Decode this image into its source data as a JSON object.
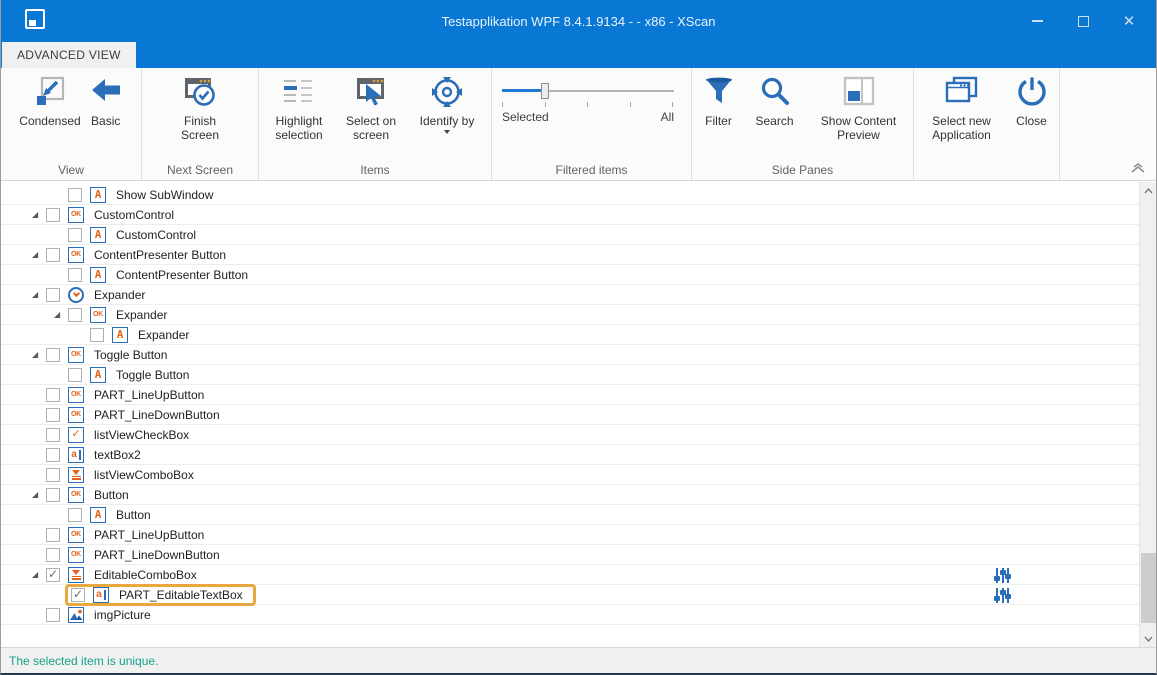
{
  "window": {
    "title": "Testapplikation WPF 8.4.1.9134 - - x86 - XScan",
    "control_icons": [
      "minimize-icon",
      "maximize-icon",
      "close-icon"
    ],
    "app_icon": "save-window-icon"
  },
  "tab": {
    "label": "ADVANCED VIEW"
  },
  "ribbon": {
    "groups": [
      {
        "label": "View",
        "buttons": [
          {
            "label": "Condensed",
            "icon": "condensed-icon"
          },
          {
            "label": "Basic",
            "icon": "basic-icon"
          }
        ]
      },
      {
        "label": "Next Screen",
        "buttons": [
          {
            "label": "Finish Screen",
            "icon": "finish-screen-icon"
          }
        ]
      },
      {
        "label": "Items",
        "buttons": [
          {
            "label": "Highlight selection",
            "icon": "highlight-selection-icon"
          },
          {
            "label": "Select on screen",
            "icon": "select-on-screen-icon"
          },
          {
            "label": "Identify by",
            "icon": "identify-by-icon",
            "dropdown": true
          }
        ]
      },
      {
        "label": "Filtered items",
        "slider": {
          "left_label": "Selected",
          "right_label": "All",
          "value_fraction": 0.25,
          "tick_count": 5
        }
      },
      {
        "label": "Side Panes",
        "buttons": [
          {
            "label": "Filter",
            "icon": "filter-icon"
          },
          {
            "label": "Search",
            "icon": "search-icon"
          },
          {
            "label": "Show Content Preview",
            "icon": "show-content-preview-icon"
          }
        ]
      },
      {
        "label": "",
        "buttons": [
          {
            "label": "Select new Application",
            "icon": "select-new-application-icon"
          },
          {
            "label": "Close",
            "icon": "close-app-icon"
          }
        ]
      }
    ],
    "collapse_icon": "collapse-ribbon-chevron-icon"
  },
  "tree": {
    "rows": [
      {
        "level": 1,
        "expander": false,
        "checked": false,
        "icon": "raw-item",
        "label": "Show SubWindow"
      },
      {
        "level": 0,
        "expander": true,
        "checked": false,
        "icon": "button",
        "label": "CustomControl"
      },
      {
        "level": 1,
        "expander": false,
        "checked": false,
        "icon": "raw-item",
        "label": "CustomControl"
      },
      {
        "level": 0,
        "expander": true,
        "checked": false,
        "icon": "button",
        "label": "ContentPresenter Button"
      },
      {
        "level": 1,
        "expander": false,
        "checked": false,
        "icon": "raw-item",
        "label": "ContentPresenter Button"
      },
      {
        "level": 0,
        "expander": true,
        "checked": false,
        "icon": "expander-control",
        "label": "Expander"
      },
      {
        "level": 1,
        "expander": true,
        "checked": false,
        "icon": "button",
        "label": "Expander"
      },
      {
        "level": 2,
        "expander": false,
        "checked": false,
        "icon": "raw-item",
        "label": "Expander"
      },
      {
        "level": 0,
        "expander": true,
        "checked": false,
        "icon": "button",
        "label": "Toggle Button"
      },
      {
        "level": 1,
        "expander": false,
        "checked": false,
        "icon": "raw-item",
        "label": "Toggle Button"
      },
      {
        "level": 0,
        "expander": false,
        "checked": false,
        "icon": "button",
        "label": "PART_LineUpButton"
      },
      {
        "level": 0,
        "expander": false,
        "checked": false,
        "icon": "button",
        "label": "PART_LineDownButton"
      },
      {
        "level": 0,
        "expander": false,
        "checked": false,
        "icon": "checkbox-control",
        "label": "listViewCheckBox"
      },
      {
        "level": 0,
        "expander": false,
        "checked": false,
        "icon": "textbox-control",
        "label": "textBox2"
      },
      {
        "level": 0,
        "expander": false,
        "checked": false,
        "icon": "combobox-control",
        "label": "listViewComboBox"
      },
      {
        "level": 0,
        "expander": true,
        "checked": false,
        "icon": "button",
        "label": "Button"
      },
      {
        "level": 1,
        "expander": false,
        "checked": false,
        "icon": "raw-item",
        "label": "Button"
      },
      {
        "level": 0,
        "expander": false,
        "checked": false,
        "icon": "button",
        "label": "PART_LineUpButton"
      },
      {
        "level": 0,
        "expander": false,
        "checked": false,
        "icon": "button",
        "label": "PART_LineDownButton"
      },
      {
        "level": 0,
        "expander": true,
        "checked": true,
        "icon": "combobox-control",
        "label": "EditableComboBox",
        "trailing_icon": "tune-sliders-icon"
      },
      {
        "level": 1,
        "expander": false,
        "checked": true,
        "icon": "textbox-control",
        "label": "PART_EditableTextBox",
        "highlighted": true,
        "trailing_icon": "tune-sliders-icon"
      },
      {
        "level": 0,
        "expander": false,
        "checked": false,
        "icon": "picture-control",
        "label": "imgPicture"
      }
    ]
  },
  "status": {
    "message": "The selected item is unique."
  },
  "colors": {
    "titlebar_blue": "#0878d4",
    "icon_blue": "#2a6db8",
    "tree_glyph_orange": "#e5621c",
    "highlight_orange": "#eaa63f",
    "status_green": "#16a08c",
    "ribbon_bg": "#fbfbfb"
  }
}
